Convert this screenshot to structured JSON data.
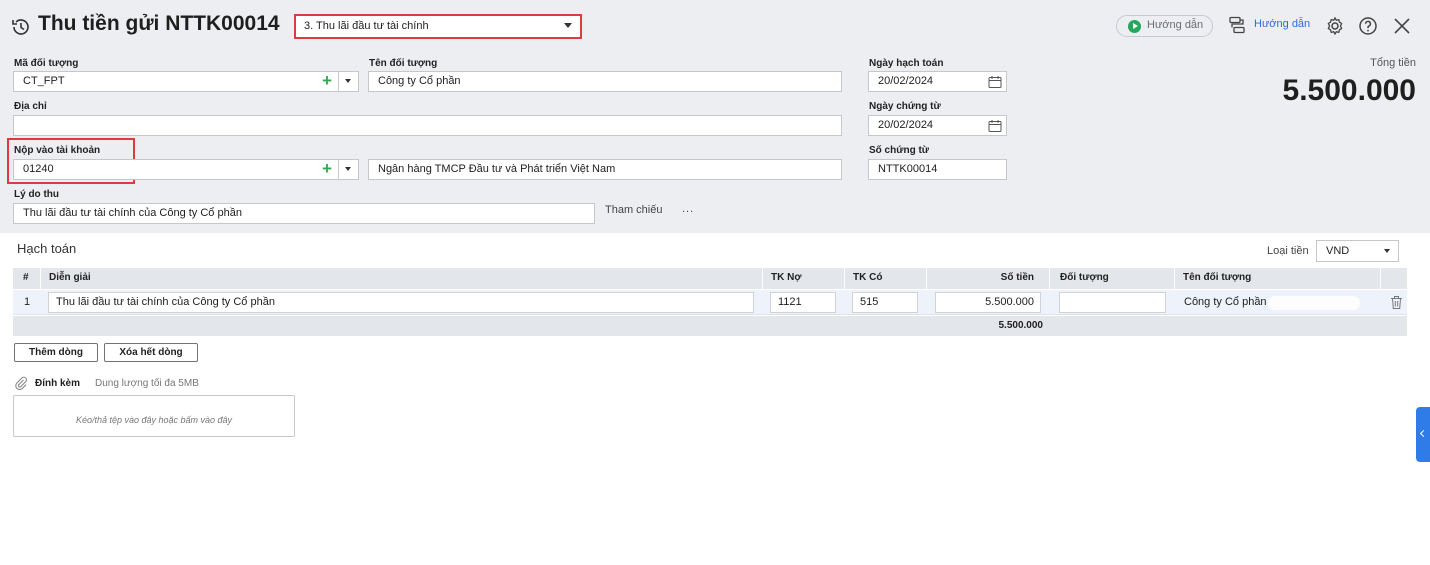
{
  "header": {
    "title": "Thu tiền gửi NTTK00014",
    "type_select_value": "3. Thu lãi đầu tư tài chính",
    "guide_pill_label": "Hướng dẫn",
    "guide_link_label": "Hướng dẫn"
  },
  "form": {
    "ma_doi_tuong": {
      "label": "Mã đối tượng",
      "value": "CT_FPT"
    },
    "ten_doi_tuong": {
      "label": "Tên đối tượng",
      "value": "Công ty Cổ phần"
    },
    "dia_chi": {
      "label": "Địa chỉ",
      "value": ""
    },
    "nop_vao_tai_khoan": {
      "label": "Nộp vào tài khoản",
      "value": "01240"
    },
    "ten_ngan_hang": {
      "value": "Ngân hàng TMCP Đầu tư và Phát triển Việt Nam"
    },
    "ly_do_thu": {
      "label": "Lý do thu",
      "value": "Thu lãi đầu tư tài chính của Công ty Cổ phần"
    },
    "tham_chieu": "Tham chiếu",
    "ngay_hach_toan": {
      "label": "Ngày hạch toán",
      "value": "20/02/2024"
    },
    "ngay_chung_tu": {
      "label": "Ngày chứng từ",
      "value": "20/02/2024"
    },
    "so_chung_tu": {
      "label": "Số chứng từ",
      "value": "NTTK00014"
    }
  },
  "total": {
    "label": "Tổng tiền",
    "value": "5.500.000"
  },
  "accounting": {
    "section_title": "Hạch toán",
    "currency_label": "Loại tiền",
    "currency_value": "VND",
    "columns": [
      "#",
      "Diễn giải",
      "TK Nợ",
      "TK Có",
      "Số tiền",
      "Đối tượng",
      "Tên đối tượng"
    ],
    "rows": [
      {
        "num": "1",
        "dien_giai": "Thu lãi đầu tư tài chính của Công ty Cổ phần",
        "tk_no": "1121",
        "tk_co": "515",
        "so_tien": "5.500.000",
        "doi_tuong": "",
        "ten_doi_tuong": "Công ty Cổ phần"
      }
    ],
    "footer_total": "5.500.000",
    "add_row_label": "Thêm dòng",
    "delete_all_label": "Xóa hết dòng"
  },
  "attachment": {
    "label": "Đính kèm",
    "note": "Dung lượng tối đa 5MB",
    "dropzone_text": "Kéo/thả tệp vào đây hoặc bấm vào đây"
  },
  "colors": {
    "highlight_border": "#e0393e",
    "accent_blue": "#2f7be8",
    "plus_green": "#2bad4e"
  }
}
